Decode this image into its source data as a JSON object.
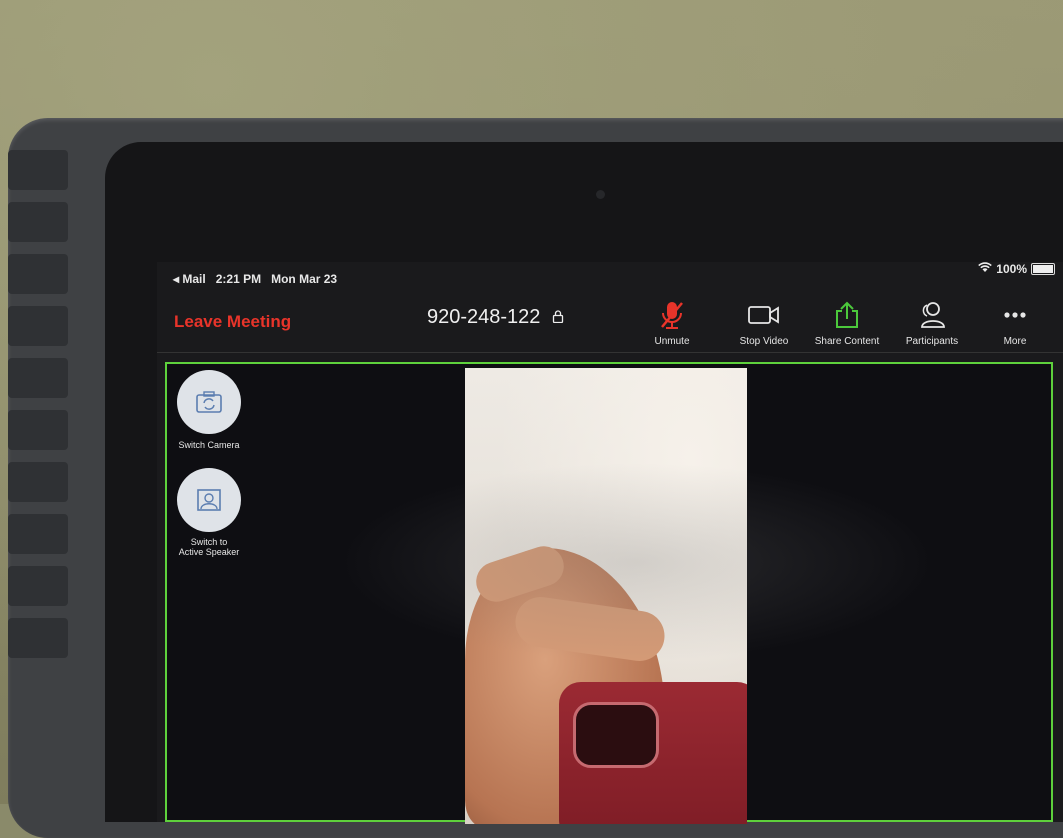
{
  "status_bar": {
    "back_app": "◂ Mail",
    "time": "2:21 PM",
    "date": "Mon Mar 23",
    "battery": "100%"
  },
  "toolbar": {
    "leave_label": "Leave Meeting",
    "meeting_id": "920-248-122",
    "buttons": [
      {
        "label": "Unmute",
        "icon": "muted-microphone-icon"
      },
      {
        "label": "Stop Video",
        "icon": "video-camera-icon"
      },
      {
        "label": "Share Content",
        "icon": "share-upload-icon"
      },
      {
        "label": "Participants",
        "icon": "participants-icon"
      },
      {
        "label": "More",
        "icon": "more-dots-icon"
      }
    ]
  },
  "side_controls": {
    "switch_camera": "Switch Camera",
    "switch_speaker": "Switch to\nActive Speaker"
  },
  "colors": {
    "leave": "#e8342a",
    "mute_icon": "#e8342a",
    "share_icon": "#4cc93c",
    "active_border": "#5ed13c"
  }
}
